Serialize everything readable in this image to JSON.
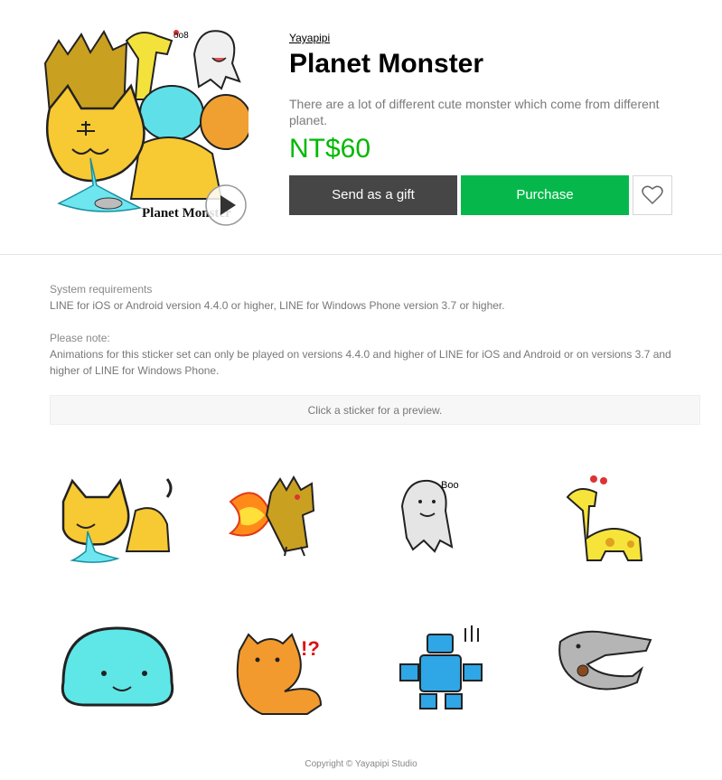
{
  "product": {
    "creator": "Yayapipi",
    "title": "Planet Monster",
    "description": "There are a lot of different cute monster which come from different planet.",
    "price": "NT$60",
    "cover_text": "Planet Monster",
    "cover_boo": "oo8"
  },
  "actions": {
    "gift_label": "Send as a gift",
    "purchase_label": "Purchase",
    "favorite_icon": "heart-outline-icon",
    "play_icon": "play-icon"
  },
  "info": {
    "sysreq_title": "System requirements",
    "sysreq_text": "LINE for iOS or Android version 4.4.0 or higher, LINE for Windows Phone version 3.7 or higher.",
    "note_title": "Please note:",
    "note_text": "Animations for this sticker set can only be played on versions 4.4.0 and higher of LINE for iOS and Android or on versions 3.7 and higher of LINE for Windows Phone."
  },
  "preview": {
    "hint": "Click a sticker for a preview.",
    "stickers": [
      {
        "name": "tiger-sticker"
      },
      {
        "name": "fire-dino-sticker"
      },
      {
        "name": "ghost-sticker",
        "text": "Boo"
      },
      {
        "name": "giraffe-sticker"
      },
      {
        "name": "blob-sticker"
      },
      {
        "name": "bear-sticker",
        "text": "!?"
      },
      {
        "name": "robot-sticker"
      },
      {
        "name": "croc-sticker"
      }
    ]
  },
  "colors": {
    "price": "#00b900",
    "purchase": "#06b84b",
    "gift": "#464646"
  },
  "footer": {
    "copyright": "Copyright © Yayapipi Studio"
  }
}
